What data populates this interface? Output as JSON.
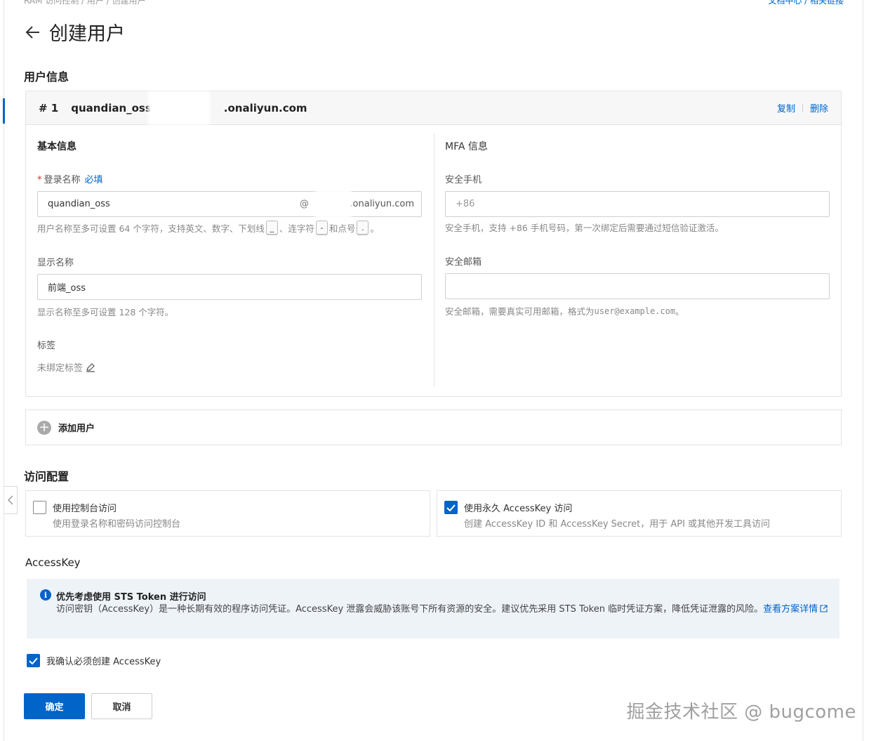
{
  "breadcrumb": {
    "partial_text": "RAM 访问控制  /  用户  /  创建用户"
  },
  "top_links": {
    "partial_text": "文档中心  /  相关链接"
  },
  "page": {
    "title": "创建用户",
    "back_icon": "arrow-left-icon"
  },
  "user_info": {
    "section_title": "用户信息",
    "card": {
      "index": "# 1",
      "username_prefix": "quandian_oss@",
      "username_suffix": ".onaliyun.com",
      "copy_label": "复制",
      "delete_label": "删除"
    },
    "basic": {
      "title": "基本信息",
      "login_name": {
        "label": "登录名称",
        "required_tag": "必填",
        "value": "quandian_oss",
        "at": "@",
        "suffix": ".onaliyun.com",
        "help_part1": "用户名称至多可设置 64 个字符，支持英文、数字、下划线",
        "help_underscore": "_",
        "help_part2": "、连字符",
        "help_dash": "-",
        "help_part3": "和点号",
        "help_dot": ".",
        "help_end": "。"
      },
      "display_name": {
        "label": "显示名称",
        "value": "前端_oss",
        "help": "显示名称至多可设置 128 个字符。"
      },
      "tags": {
        "label": "标签",
        "empty_text": "未绑定标签"
      }
    },
    "mfa": {
      "title": "MFA 信息",
      "phone": {
        "label": "安全手机",
        "placeholder": "+86",
        "help": "安全手机，支持 +86 手机号码，第一次绑定后需要通过短信验证激活。"
      },
      "email": {
        "label": "安全邮箱",
        "value": "",
        "help_text": "安全邮箱，需要真实可用邮箱，格式为 ",
        "help_example": "user@example.com",
        "help_end": "。"
      }
    }
  },
  "add_user": {
    "label": "添加用户"
  },
  "access": {
    "section_title": "访问配置",
    "console": {
      "title": "使用控制台访问",
      "desc": "使用登录名称和密码访问控制台",
      "checked": false
    },
    "accesskey": {
      "title": "使用永久 AccessKey 访问",
      "desc": "创建 AccessKey ID 和 AccessKey Secret，用于 API 或其他开发工具访问",
      "checked": true
    }
  },
  "accesskey_section": {
    "title": "AccessKey",
    "alert": {
      "title": "优先考虑使用 STS Token 进行访问",
      "body": "访问密钥（AccessKey）是一种长期有效的程序访问凭证。AccessKey 泄露会威胁该账号下所有资源的安全。建议优先采用 STS Token 临时凭证方案，降低凭证泄露的风险。",
      "link": "查看方案详情"
    },
    "confirm": {
      "label": "我确认必须创建 AccessKey",
      "checked": true
    }
  },
  "buttons": {
    "ok": "确定",
    "cancel": "取消"
  },
  "watermark": "掘金技术社区 @ bugcome",
  "colors": {
    "primary": "#0064c8",
    "required": "#d93026",
    "alert_bg": "#eef3f8"
  }
}
